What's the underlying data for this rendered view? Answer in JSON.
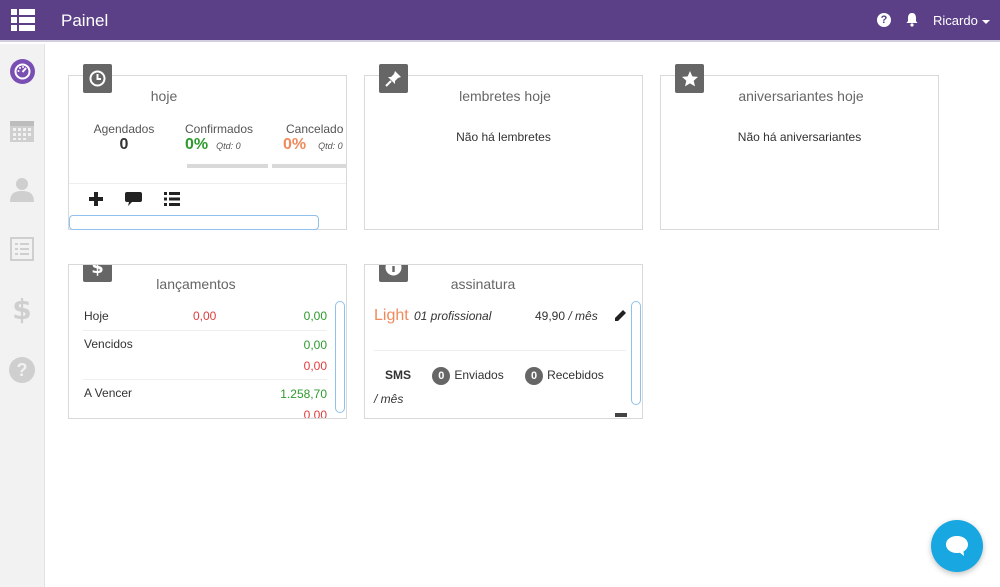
{
  "topbar": {
    "brand": "Painel",
    "user": "Ricardo",
    "help_glyph": "?"
  },
  "colors": {
    "topbar": "#5b3f87",
    "positive": "#2e9a2e",
    "negative": "#e03c3c",
    "accent_orange": "#f08a5d",
    "chat": "#18a7e0"
  },
  "sidebar": {
    "items": [
      {
        "icon": "dashboard-icon",
        "active": true
      },
      {
        "icon": "calendar-icon",
        "active": false
      },
      {
        "icon": "user-icon",
        "active": false
      },
      {
        "icon": "list-icon",
        "active": false
      },
      {
        "icon": "dollar-icon",
        "active": false
      },
      {
        "icon": "help-icon",
        "active": false
      }
    ]
  },
  "hoje": {
    "title": "hoje",
    "agendados": {
      "label": "Agendados",
      "value": "0"
    },
    "confirmados": {
      "label": "Confirmados",
      "value": "0%",
      "qtd": "Qtd: 0"
    },
    "cancelados": {
      "label": "Cancelado",
      "value": "0%",
      "qtd": "Qtd: 0"
    }
  },
  "lembretes": {
    "title": "lembretes hoje",
    "message": "Não há lembretes"
  },
  "aniversariantes": {
    "title": "aniversariantes hoje",
    "message": "Não há aniversariantes"
  },
  "lancamentos": {
    "title": "lançamentos",
    "rows": [
      {
        "label": "Hoje",
        "neg": "0,00",
        "pos": "0,00"
      },
      {
        "label": "Vencidos",
        "pos": "0,00",
        "neg2": "0,00"
      },
      {
        "label": "A Vencer",
        "pos": "1.258,70",
        "neg2": "0,00"
      }
    ]
  },
  "assinatura": {
    "title": "assinatura",
    "plan": "Light",
    "professionals": "01 profissional",
    "price": "49,90",
    "per_month": "/ mês",
    "sms_label": "SMS",
    "sent_count": "0",
    "sent_label": "Enviados",
    "received_count": "0",
    "received_label": "Recebidos",
    "sms_period": "/ mês"
  }
}
